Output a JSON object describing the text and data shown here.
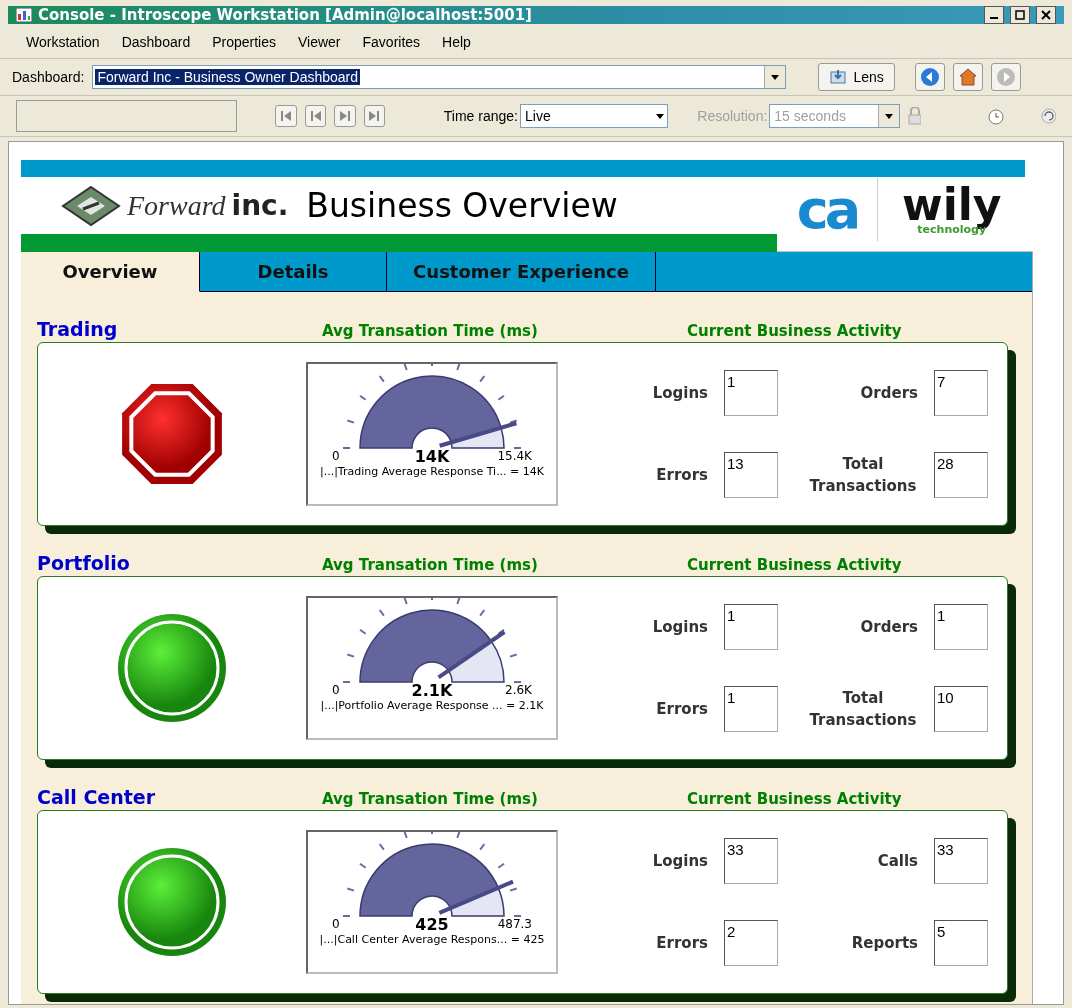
{
  "window": {
    "title": "Console - Introscope Workstation [Admin@localhost:5001]"
  },
  "menu": [
    "Workstation",
    "Dashboard",
    "Properties",
    "Viewer",
    "Favorites",
    "Help"
  ],
  "dashboard_bar": {
    "label": "Dashboard:",
    "value": "Forward Inc - Business Owner Dashboard",
    "lens_button": "Lens"
  },
  "toolbar": {
    "time_range_label": "Time range:",
    "time_range": "Live",
    "resolution_label": "Resolution:",
    "resolution": "15 seconds",
    "resolution_disabled": true
  },
  "header": {
    "brand": "Forward",
    "brand_suffix": "inc.",
    "title": "Business Overview",
    "logo_left": "ca",
    "logo_right": "wily",
    "logo_right_sub": "technology"
  },
  "tabs": [
    {
      "label": "Overview",
      "selected": true
    },
    {
      "label": "Details",
      "selected": false
    },
    {
      "label": "Customer Experience",
      "selected": false
    }
  ],
  "sections": [
    {
      "name": "Trading",
      "kind": "stop",
      "gauge_title": "Avg Transation Time (ms)",
      "activity_title": "Current Business Activity",
      "gauge": {
        "min": "0",
        "max": "15.4K",
        "value": "14K",
        "caption": "|...|Trading Average Response Ti... = 14K"
      },
      "metrics": [
        {
          "label": "Logins",
          "value": "1"
        },
        {
          "label": "Orders",
          "value": "7"
        },
        {
          "label": "Errors",
          "value": "13"
        },
        {
          "label": "Total Transactions",
          "value": "28"
        }
      ]
    },
    {
      "name": "Portfolio",
      "kind": "ok",
      "gauge_title": "Avg Transation Time (ms)",
      "activity_title": "Current Business Activity",
      "gauge": {
        "min": "0",
        "max": "2.6K",
        "value": "2.1K",
        "caption": "|...|Portfolio Average Response ... = 2.1K"
      },
      "metrics": [
        {
          "label": "Logins",
          "value": "1"
        },
        {
          "label": "Orders",
          "value": "1"
        },
        {
          "label": "Errors",
          "value": "1"
        },
        {
          "label": "Total Transactions",
          "value": "10"
        }
      ]
    },
    {
      "name": "Call Center",
      "kind": "ok",
      "gauge_title": "Avg Transation Time (ms)",
      "activity_title": "Current Business Activity",
      "gauge": {
        "min": "0",
        "max": "487.3",
        "value": "425",
        "caption": "|...|Call Center Average Respons... = 425"
      },
      "metrics": [
        {
          "label": "Logins",
          "value": "33"
        },
        {
          "label": "Calls",
          "value": "33"
        },
        {
          "label": "Errors",
          "value": "2"
        },
        {
          "label": "Reports",
          "value": "5"
        }
      ]
    }
  ]
}
